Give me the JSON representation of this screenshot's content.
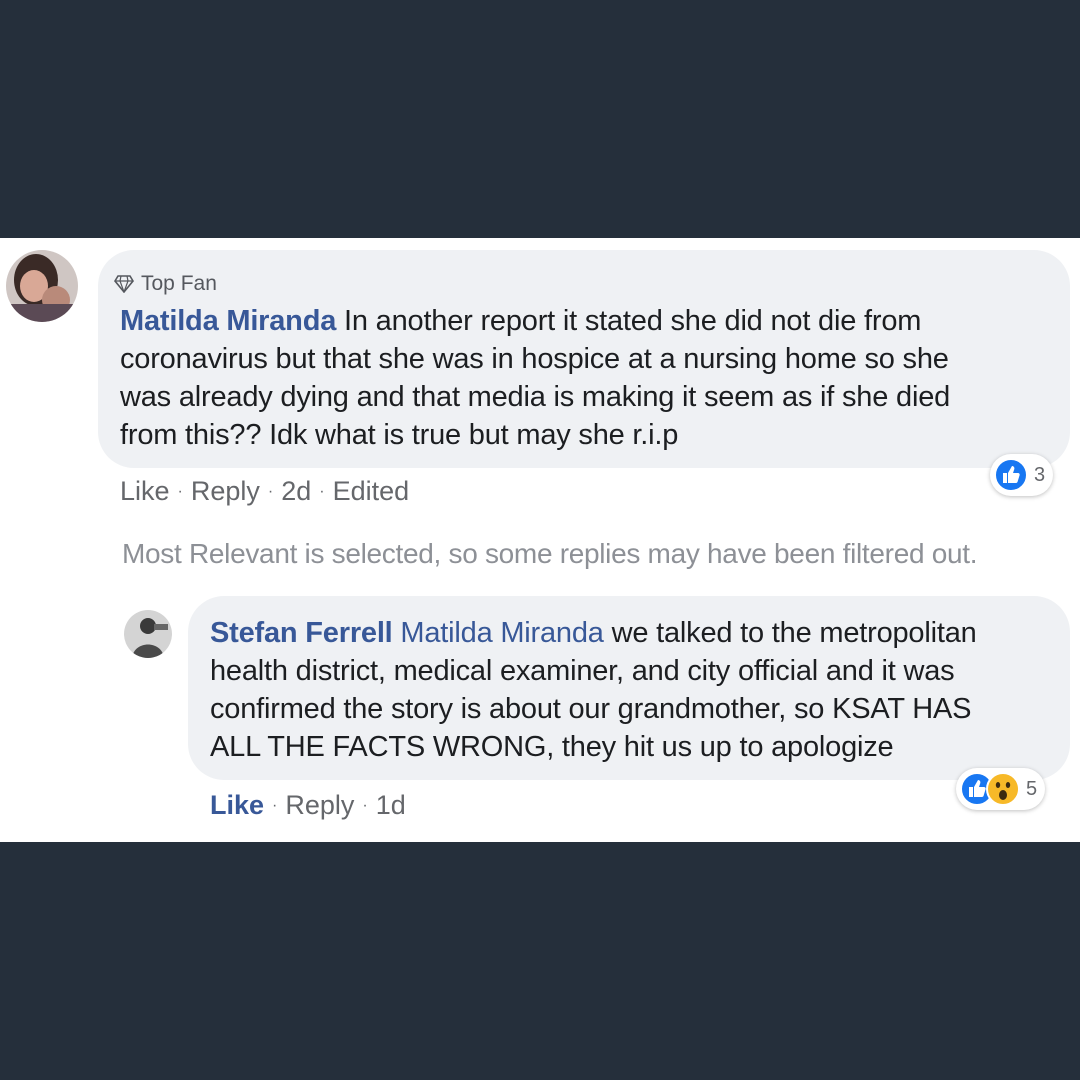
{
  "comment": {
    "badge": "Top Fan",
    "author": "Matilda Miranda",
    "text_line1": "In another report it stated she did not die from",
    "text_line2": "coronavirus but that she was in hospice at a nursing home so she",
    "text_line3": "was already dying and that media is making it seem as if she died",
    "text_line4": "from this?? Idk what is true but may she r.i.p",
    "like_label": "Like",
    "reply_label": "Reply",
    "time": "2d",
    "edited": "Edited",
    "reaction_count": "3",
    "reaction_icons": [
      "like-icon"
    ]
  },
  "filter_notice": "Most Relevant is selected, so some replies may have been filtered out.",
  "reply": {
    "author": "Stefan Ferrell",
    "mention": "Matilda Miranda",
    "text_line1": "we talked to the metropolitan",
    "text_line2": "health district, medical examiner, and city official and it was",
    "text_line3": "confirmed the story is about our grandmother, so KSAT HAS",
    "text_line4": "ALL THE FACTS WRONG, they hit us up to apologize",
    "like_label": "Like",
    "reply_label": "Reply",
    "time": "1d",
    "reaction_count": "5",
    "reaction_icons": [
      "like-icon",
      "wow-icon"
    ]
  },
  "colors": {
    "background": "#252f3b",
    "link": "#385898",
    "bubble": "#eff1f4",
    "like_blue": "#1877f2",
    "wow_yellow": "#f7b928"
  }
}
